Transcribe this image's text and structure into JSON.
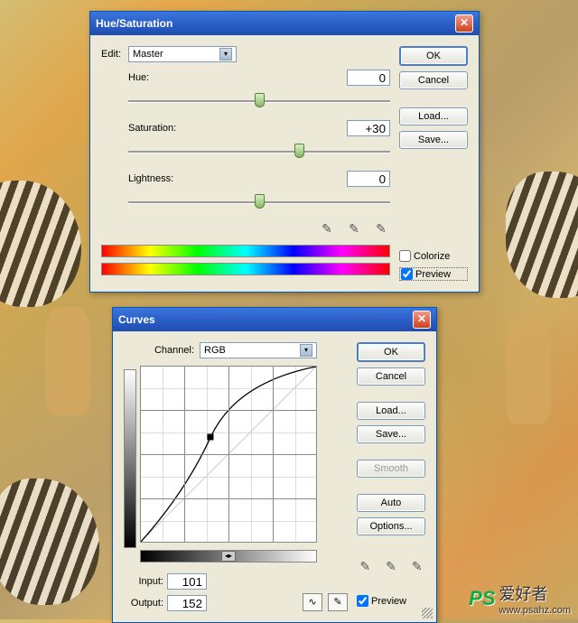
{
  "hueSat": {
    "title": "Hue/Saturation",
    "editLabel": "Edit:",
    "editValue": "Master",
    "hueLabel": "Hue:",
    "hueValue": "0",
    "satLabel": "Saturation:",
    "satValue": "+30",
    "lightLabel": "Lightness:",
    "lightValue": "0",
    "colorizeLabel": "Colorize",
    "previewLabel": "Preview",
    "colorizeChecked": false,
    "previewChecked": true,
    "buttons": {
      "ok": "OK",
      "cancel": "Cancel",
      "load": "Load...",
      "save": "Save..."
    }
  },
  "curves": {
    "title": "Curves",
    "channelLabel": "Channel:",
    "channelValue": "RGB",
    "inputLabel": "Input:",
    "inputValue": "101",
    "outputLabel": "Output:",
    "outputValue": "152",
    "previewLabel": "Preview",
    "previewChecked": true,
    "buttons": {
      "ok": "OK",
      "cancel": "Cancel",
      "load": "Load...",
      "save": "Save...",
      "smooth": "Smooth",
      "auto": "Auto",
      "options": "Options..."
    }
  },
  "chart_data": {
    "type": "line",
    "title": "Curves",
    "xlabel": "Input",
    "ylabel": "Output",
    "xlim": [
      0,
      255
    ],
    "ylim": [
      0,
      255
    ],
    "points": [
      {
        "x": 0,
        "y": 0
      },
      {
        "x": 101,
        "y": 152
      },
      {
        "x": 255,
        "y": 255
      }
    ]
  },
  "watermark": {
    "logo": "PS",
    "text": "爱好者",
    "url": "www.psahz.com"
  }
}
